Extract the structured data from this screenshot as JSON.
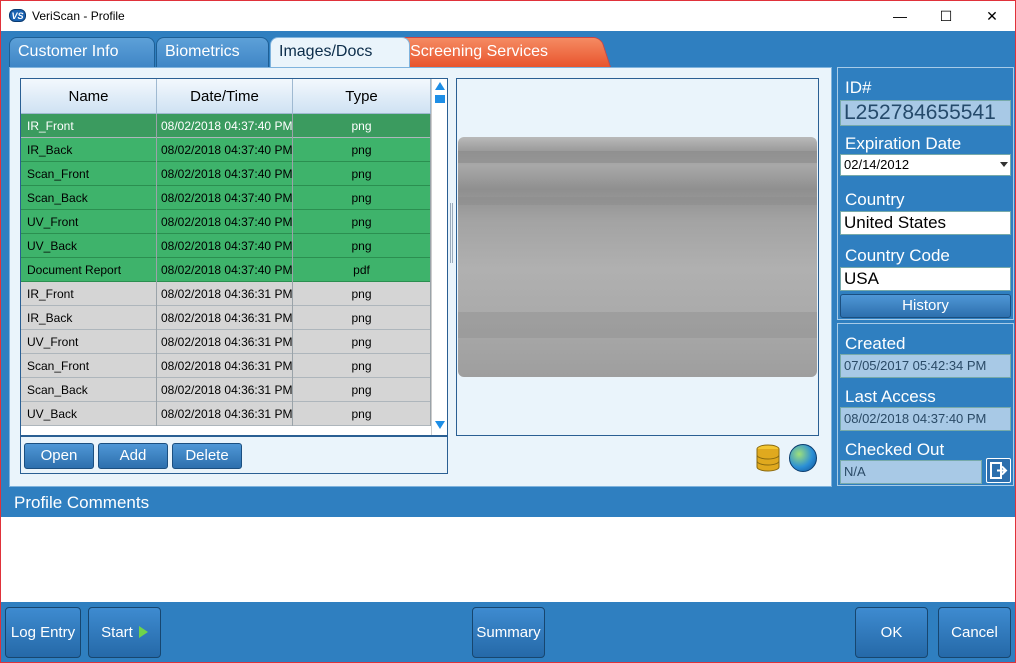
{
  "window": {
    "title": "VeriScan - Profile",
    "logo_text": "VS",
    "minimize": "—",
    "maximize": "☐",
    "close": "✕"
  },
  "tabs": [
    {
      "label": "Customer Info"
    },
    {
      "label": "Biometrics"
    },
    {
      "label": "Images/Docs",
      "active": true
    },
    {
      "label": "Screening Services"
    }
  ],
  "grid": {
    "columns": [
      "Name",
      "Date/Time",
      "Type"
    ],
    "rows": [
      {
        "name": "IR_Front",
        "datetime": "08/02/2018 04:37:40 PM",
        "type": "png"
      },
      {
        "name": "IR_Back",
        "datetime": "08/02/2018 04:37:40 PM",
        "type": "png"
      },
      {
        "name": "Scan_Front",
        "datetime": "08/02/2018 04:37:40 PM",
        "type": "png"
      },
      {
        "name": "Scan_Back",
        "datetime": "08/02/2018 04:37:40 PM",
        "type": "png"
      },
      {
        "name": "UV_Front",
        "datetime": "08/02/2018 04:37:40 PM",
        "type": "png"
      },
      {
        "name": "UV_Back",
        "datetime": "08/02/2018 04:37:40 PM",
        "type": "png"
      },
      {
        "name": "Document Report",
        "datetime": "08/02/2018 04:37:40 PM",
        "type": "pdf"
      },
      {
        "name": "IR_Front",
        "datetime": "08/02/2018 04:36:31 PM",
        "type": "png"
      },
      {
        "name": "IR_Back",
        "datetime": "08/02/2018 04:36:31 PM",
        "type": "png"
      },
      {
        "name": "UV_Front",
        "datetime": "08/02/2018 04:36:31 PM",
        "type": "png"
      },
      {
        "name": "Scan_Front",
        "datetime": "08/02/2018 04:36:31 PM",
        "type": "png"
      },
      {
        "name": "Scan_Back",
        "datetime": "08/02/2018 04:36:31 PM",
        "type": "png"
      },
      {
        "name": "UV_Back",
        "datetime": "08/02/2018 04:36:31 PM",
        "type": "png"
      }
    ]
  },
  "toolbar": {
    "open": "Open",
    "add": "Add",
    "delete": "Delete"
  },
  "profile": {
    "id_label": "ID#",
    "id_value": "L252784655541",
    "exp_label": "Expiration Date",
    "exp_value": "02/14/2012",
    "country_label": "Country",
    "country_value": "United States",
    "code_label": "Country Code",
    "code_value": "USA",
    "history": "History"
  },
  "dates": {
    "created_label": "Created",
    "created_value": "07/05/2017 05:42:34 PM",
    "access_label": "Last Access",
    "access_value": "08/02/2018 04:37:40 PM",
    "checked_label": "Checked Out",
    "checked_value": "N/A"
  },
  "comments": {
    "title": "Profile Comments"
  },
  "footer": {
    "log": "Log Entry",
    "start": "Start",
    "summary": "Summary",
    "ok": "OK",
    "cancel": "Cancel"
  }
}
